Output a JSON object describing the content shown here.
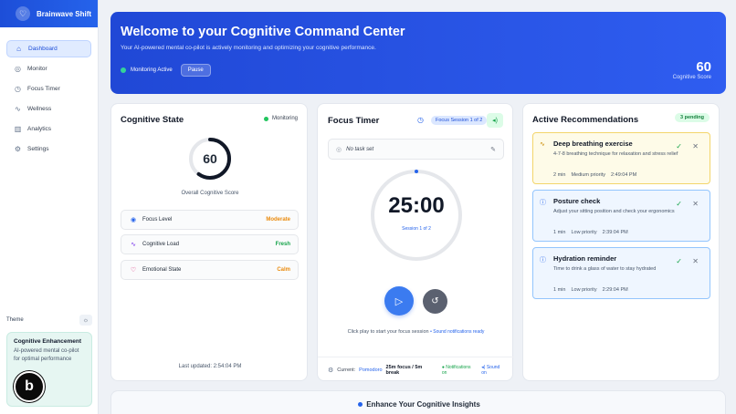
{
  "app": {
    "name": "Brainwave Shift"
  },
  "sidebar": {
    "items": [
      {
        "label": "Dashboard",
        "icon": "home-icon"
      },
      {
        "label": "Monitor",
        "icon": "monitor-icon"
      },
      {
        "label": "Focus Timer",
        "icon": "timer-icon"
      },
      {
        "label": "Wellness",
        "icon": "activity-icon"
      },
      {
        "label": "Analytics",
        "icon": "chart-icon"
      },
      {
        "label": "Settings",
        "icon": "gear-icon"
      }
    ],
    "active_index": 0,
    "theme_label": "Theme",
    "enhancement": {
      "title": "Cognitive Enhancement",
      "description": "AI-powered mental co-pilot for optimal performance"
    }
  },
  "hero": {
    "title": "Welcome to your Cognitive Command Center",
    "subtitle": "Your AI-powered mental co-pilot is actively monitoring and optimizing your cognitive performance.",
    "status": "Monitoring Active",
    "pause_label": "Pause",
    "score": "60",
    "score_label": "Cognitive Score"
  },
  "cognitive_state": {
    "title": "Cognitive State",
    "monitoring_label": "Monitoring",
    "score": "60",
    "score_fraction": 0.6,
    "score_label": "Overall Cognitive Score",
    "metrics": [
      {
        "name": "Focus Level",
        "value": "Moderate",
        "color": "#ea8a0c"
      },
      {
        "name": "Cognitive Load",
        "value": "Fresh",
        "color": "#16a34a"
      },
      {
        "name": "Emotional State",
        "value": "Calm",
        "color": "#ea8a0c"
      }
    ],
    "last_updated": "Last updated: 2:54:04 PM"
  },
  "focus_timer": {
    "title": "Focus Timer",
    "session_pill": "Focus Session 1 of 2",
    "task_placeholder": "No task set",
    "time": "25:00",
    "session_label": "Session 1 of 2",
    "hint": "Click play to start your focus session",
    "hint_sound": "• Sound notifications ready",
    "current_label": "Current:",
    "mode": "Pomodoro",
    "cycle": "25m focus / 5m break",
    "notifications": "Notifications on",
    "sound": "Sound on"
  },
  "recommendations": {
    "title": "Active Recommendations",
    "pending": "3 pending",
    "items": [
      {
        "title": "Deep breathing exercise",
        "description": "4-7-8 breathing technique for relaxation and stress relief",
        "duration": "2 min",
        "priority": "Medium priority",
        "time": "2:49:04 PM",
        "icon": "pulse-icon"
      },
      {
        "title": "Posture check",
        "description": "Adjust your sitting position and check your ergonomics",
        "duration": "1 min",
        "priority": "Low priority",
        "time": "2:39:04 PM",
        "icon": "info-icon"
      },
      {
        "title": "Hydration reminder",
        "description": "Time to drink a glass of water to stay hydrated",
        "duration": "1 min",
        "priority": "Low priority",
        "time": "2:29:04 PM",
        "icon": "info-icon"
      }
    ]
  },
  "insights": {
    "title": "Enhance Your Cognitive Insights"
  },
  "colors": {
    "primary": "#2563eb",
    "success": "#16a34a",
    "warning": "#ea8a0c"
  }
}
